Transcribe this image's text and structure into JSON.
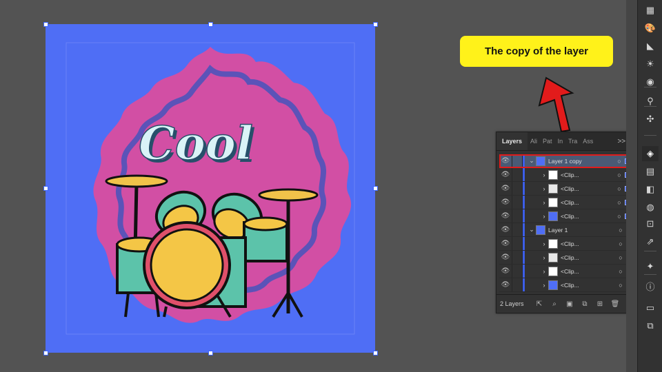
{
  "callout": {
    "text": "The copy of the layer"
  },
  "artwork": {
    "word": "Cool"
  },
  "layers_panel": {
    "tabs": [
      "Layers",
      "Ali",
      "Pat",
      "In",
      "Tra",
      "Ass"
    ],
    "overflow": ">>",
    "menu": "≡",
    "rows": [
      {
        "name": "Layer 1 copy",
        "level": 0,
        "expanded": true,
        "thumb": "layer",
        "selected": true,
        "highlighted": true,
        "square": true
      },
      {
        "name": "<Clip...",
        "level": 1,
        "thumb": "white",
        "square": true
      },
      {
        "name": "<Clip...",
        "level": 1,
        "thumb": "drum",
        "square": true
      },
      {
        "name": "<Clip...",
        "level": 1,
        "thumb": "pink",
        "square": true
      },
      {
        "name": "<Clip...",
        "level": 1,
        "thumb": "blue",
        "square": true
      },
      {
        "name": "Layer 1",
        "level": 0,
        "expanded": true,
        "thumb": "layer",
        "square": false
      },
      {
        "name": "<Clip...",
        "level": 1,
        "thumb": "white",
        "square": false
      },
      {
        "name": "<Clip...",
        "level": 1,
        "thumb": "drum",
        "square": false
      },
      {
        "name": "<Clip...",
        "level": 1,
        "thumb": "pink",
        "square": false
      },
      {
        "name": "<Clip...",
        "level": 1,
        "thumb": "blue",
        "square": false
      }
    ],
    "footer": {
      "count": "2 Layers"
    }
  },
  "colors": {
    "artboard": "#4f6ef5",
    "badge": "#d64fa3",
    "callout": "#fff21a",
    "highlight": "#e21b1b",
    "selection": "#3c5ee8"
  },
  "toolbar_icons": [
    "swatches-icon",
    "brushes-icon",
    "gradient-icon",
    "appearance-icon",
    "graphic-styles-icon",
    "puppet-warp-icon",
    "symbols-icon",
    "layers-icon",
    "align-icon",
    "pathfinder-icon",
    "transform-icon",
    "artboards-icon",
    "export-icon",
    "magic-wand-icon",
    "info-icon",
    "gradient-panel-icon",
    "transparency-icon"
  ]
}
